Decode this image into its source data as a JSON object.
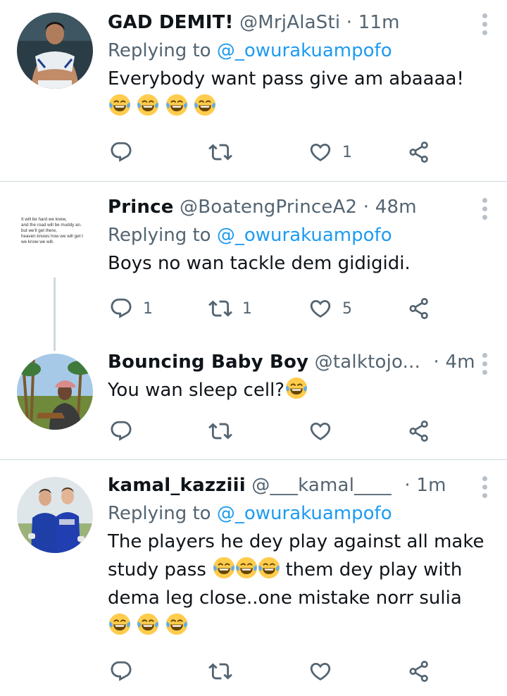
{
  "tweets": [
    {
      "name": "GAD DEMIT!",
      "handle": "@MrjAlaSti",
      "dot": "·",
      "time": "11m",
      "replying_label": "Replying to",
      "replying_to": "@_owurakuampofo",
      "lines": [
        "Everybody want pass give am abaaaa!"
      ],
      "emoji_line_count": 4,
      "reply_count": "",
      "retweet_count": "",
      "like_count": "1"
    },
    {
      "name": "Prince",
      "handle": "@BoatengPrinceA2",
      "dot": "·",
      "time": "48m",
      "replying_label": "Replying to",
      "replying_to": "@_owurakuampofo",
      "lines": [
        "Boys no wan tackle dem gidigidi."
      ],
      "avatar_text": [
        "It will be hard we knew,",
        "and the road will be muddy an.",
        "but we'll get there,",
        "heaven knows how we will get t",
        "we know we will."
      ],
      "reply_count": "1",
      "retweet_count": "1",
      "like_count": "5"
    },
    {
      "name": "Bouncing Baby Boy",
      "handle": "@talktojo...",
      "dot": "·",
      "time": "4m",
      "lines": [
        "You wan sleep cell?"
      ],
      "reply_count": "",
      "retweet_count": "",
      "like_count": ""
    },
    {
      "name": "kamal_kazziii",
      "handle": "@___kamal____",
      "dot": "·",
      "time": "1m",
      "replying_label": "Replying to",
      "replying_to": "@_owurakuampofo",
      "lines": [
        "The players he dey play against all make",
        "study pass",
        "them dey play with",
        "dema leg close..one mistake norr sulia"
      ],
      "reply_count": "",
      "retweet_count": "",
      "like_count": ""
    }
  ],
  "colors": {
    "text": "#0f1419",
    "secondary": "#536471",
    "link": "#1d9bf0",
    "divider": "#cfd9de",
    "icon": "#536471"
  },
  "icons": [
    "reply-icon",
    "retweet-icon",
    "like-icon",
    "share-icon",
    "more-icon",
    "laughing-emoji"
  ]
}
